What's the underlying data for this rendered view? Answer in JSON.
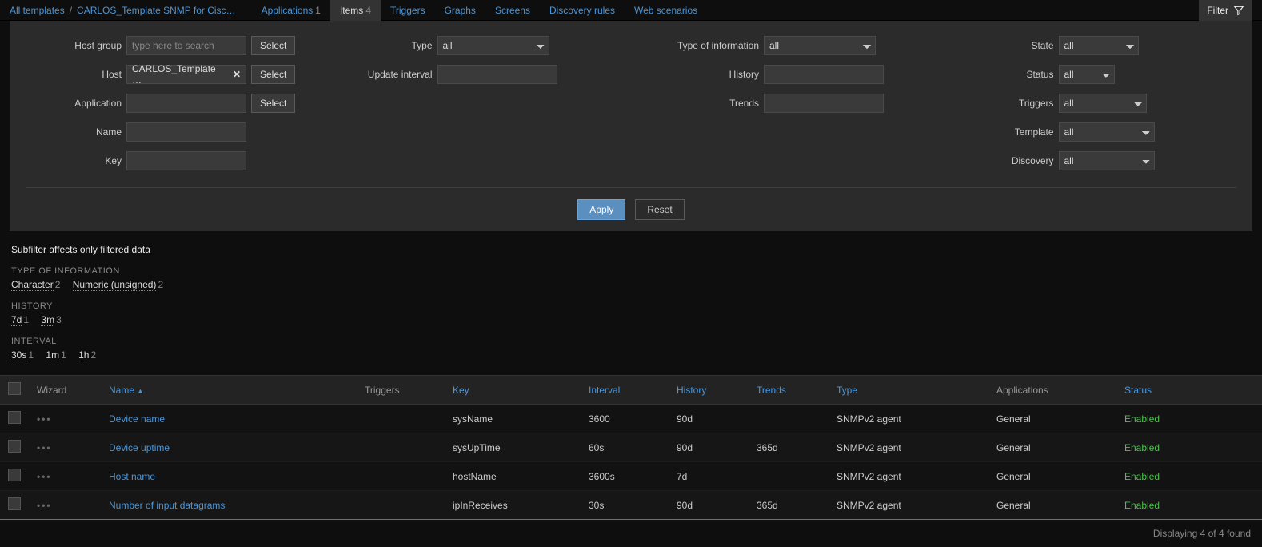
{
  "breadcrumb": {
    "root": "All templates",
    "current": "CARLOS_Template SNMP for Cisc…"
  },
  "tabs": [
    {
      "label": "Applications",
      "count": "1"
    },
    {
      "label": "Items",
      "count": "4",
      "active": true
    },
    {
      "label": "Triggers"
    },
    {
      "label": "Graphs"
    },
    {
      "label": "Screens"
    },
    {
      "label": "Discovery rules"
    },
    {
      "label": "Web scenarios"
    }
  ],
  "filter_toggle_label": "Filter",
  "filter": {
    "host_group": {
      "label": "Host group",
      "placeholder": "type here to search",
      "select": "Select"
    },
    "host": {
      "label": "Host",
      "chip": "CARLOS_Template …",
      "select": "Select"
    },
    "application": {
      "label": "Application",
      "select": "Select"
    },
    "name": {
      "label": "Name"
    },
    "key": {
      "label": "Key"
    },
    "type": {
      "label": "Type",
      "value": "all"
    },
    "update_interval": {
      "label": "Update interval"
    },
    "type_info": {
      "label": "Type of information",
      "value": "all"
    },
    "history": {
      "label": "History"
    },
    "trends": {
      "label": "Trends"
    },
    "state": {
      "label": "State",
      "value": "all"
    },
    "status": {
      "label": "Status",
      "value": "all"
    },
    "triggers": {
      "label": "Triggers",
      "value": "all"
    },
    "template": {
      "label": "Template",
      "value": "all"
    },
    "discovery": {
      "label": "Discovery",
      "value": "all"
    },
    "apply": "Apply",
    "reset": "Reset"
  },
  "subfilter": {
    "title": "Subfilter",
    "note": "affects only filtered data",
    "groups": [
      {
        "heading": "TYPE OF INFORMATION",
        "items": [
          {
            "label": "Character",
            "count": "2"
          },
          {
            "label": "Numeric (unsigned)",
            "count": "2"
          }
        ]
      },
      {
        "heading": "HISTORY",
        "items": [
          {
            "label": "7d",
            "count": "1"
          },
          {
            "label": "3m",
            "count": "3"
          }
        ]
      },
      {
        "heading": "INTERVAL",
        "items": [
          {
            "label": "30s",
            "count": "1"
          },
          {
            "label": "1m",
            "count": "1"
          },
          {
            "label": "1h",
            "count": "2"
          }
        ]
      }
    ]
  },
  "table": {
    "headers": {
      "wizard": "Wizard",
      "name": "Name",
      "triggers": "Triggers",
      "key": "Key",
      "interval": "Interval",
      "history": "History",
      "trends": "Trends",
      "type": "Type",
      "applications": "Applications",
      "status": "Status"
    },
    "rows": [
      {
        "name": "Device name",
        "key": "sysName",
        "interval": "3600",
        "history": "90d",
        "trends": "",
        "type": "SNMPv2 agent",
        "applications": "General",
        "status": "Enabled"
      },
      {
        "name": "Device uptime",
        "key": "sysUpTime",
        "interval": "60s",
        "history": "90d",
        "trends": "365d",
        "type": "SNMPv2 agent",
        "applications": "General",
        "status": "Enabled"
      },
      {
        "name": "Host name",
        "key": "hostName",
        "interval": "3600s",
        "history": "7d",
        "trends": "",
        "type": "SNMPv2 agent",
        "applications": "General",
        "status": "Enabled"
      },
      {
        "name": "Number of input datagrams",
        "key": "ipInReceives",
        "interval": "30s",
        "history": "90d",
        "trends": "365d",
        "type": "SNMPv2 agent",
        "applications": "General",
        "status": "Enabled",
        "highlight": true
      }
    ]
  },
  "footer": "Displaying 4 of 4 found"
}
